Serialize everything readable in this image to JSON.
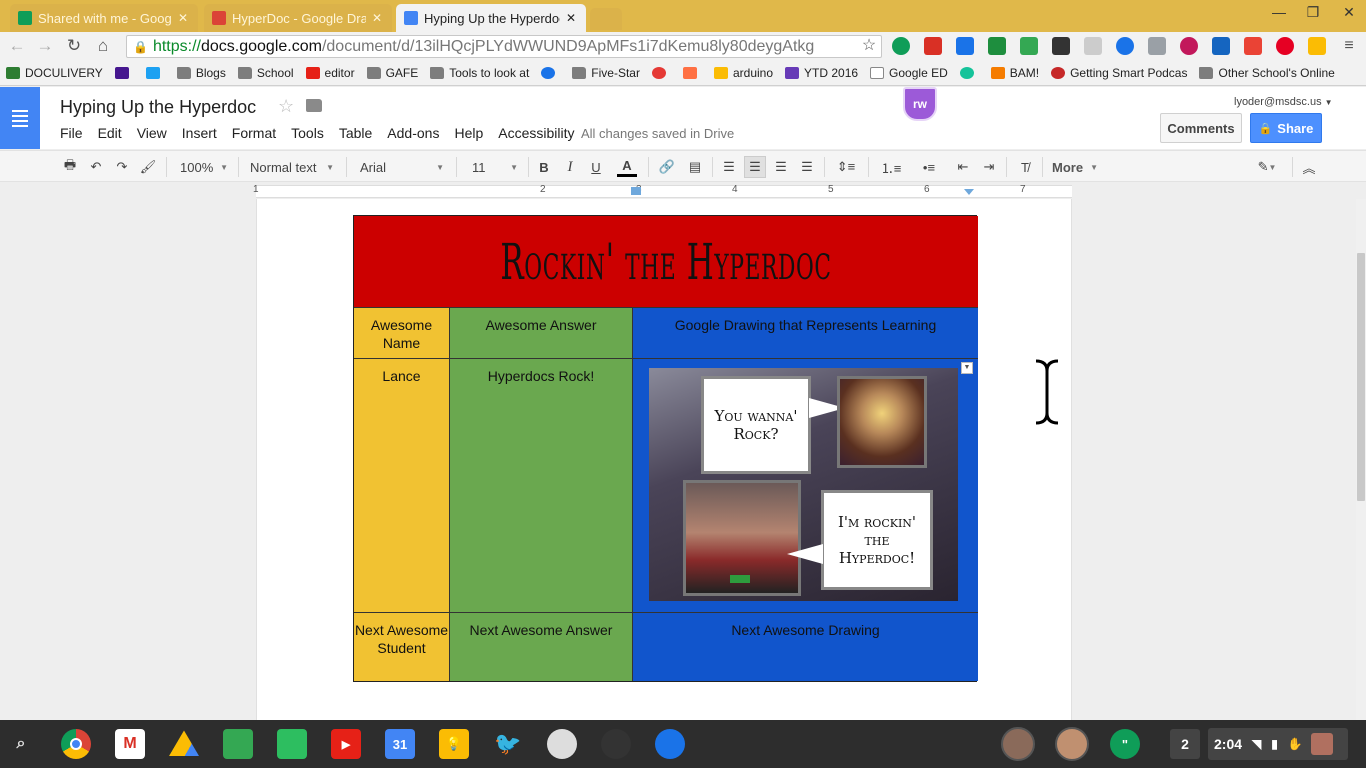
{
  "browser": {
    "tabs": [
      {
        "title": "Shared with me - Google D",
        "active": false,
        "favicon_color": "#0f9d58"
      },
      {
        "title": "HyperDoc - Google Drawi",
        "active": false,
        "favicon_color": "#db4437"
      },
      {
        "title": "Hyping Up the Hyperdoc -",
        "active": true,
        "favicon_color": "#4285f4"
      }
    ],
    "url": {
      "scheme": "https://",
      "host": "docs.google.com",
      "path": "/document/d/13ilHQcjPLYdWWUND9ApMFs1i7dKemu8ly80deygAtkg"
    },
    "bookmarks": [
      {
        "label": "DOCULIVERY",
        "icon": "doculivery-icon"
      },
      {
        "label": "",
        "icon": "kahoot-icon"
      },
      {
        "label": "",
        "icon": "twitter-icon"
      },
      {
        "label": "Blogs",
        "icon": "folder-icon"
      },
      {
        "label": "School",
        "icon": "folder-icon"
      },
      {
        "label": "editor",
        "icon": "youtube-icon"
      },
      {
        "label": "GAFE",
        "icon": "folder-icon"
      },
      {
        "label": "Tools to look at",
        "icon": "folder-icon"
      },
      {
        "label": "",
        "icon": "clock-icon"
      },
      {
        "label": "Five-Star",
        "icon": "folder-icon"
      },
      {
        "label": "",
        "icon": "app-icon"
      },
      {
        "label": "",
        "icon": "app-icon"
      },
      {
        "label": "arduino",
        "icon": "drive-icon"
      },
      {
        "label": "YTD 2016",
        "icon": "forms-icon"
      },
      {
        "label": "Google ED",
        "icon": "page-icon"
      },
      {
        "label": "",
        "icon": "grammarly-icon"
      },
      {
        "label": "BAM!",
        "icon": "bam-icon"
      },
      {
        "label": "Getting Smart Podcas",
        "icon": "podcast-icon"
      },
      {
        "label": "Other School's Online",
        "icon": "folder-icon"
      }
    ]
  },
  "docs": {
    "title": "Hyping Up the Hyperdoc",
    "menu": [
      "File",
      "Edit",
      "View",
      "Insert",
      "Format",
      "Tools",
      "Table",
      "Add-ons",
      "Help",
      "Accessibility"
    ],
    "saved_status": "All changes saved in Drive",
    "user_email": "lyoder@msdsc.us",
    "comments_label": "Comments",
    "share_label": "Share",
    "rw_label": "rw",
    "toolbar": {
      "zoom": "100%",
      "style": "Normal text",
      "font": "Arial",
      "size": "11",
      "bold": "B",
      "italic": "I",
      "underline": "U",
      "text_color": "A",
      "more": "More"
    },
    "ruler_numbers": [
      "1",
      "2",
      "3",
      "4",
      "5",
      "6",
      "7"
    ]
  },
  "table": {
    "title": "Rockin' the Hyperdoc",
    "header_row": [
      "Awesome Name",
      "Awesome Answer",
      "Google Drawing that Represents Learning"
    ],
    "row1": [
      "Lance",
      "Hyperdocs Rock!"
    ],
    "row2": [
      "Next Awesome Student",
      "Next Awesome Answer",
      "Next Awesome Drawing"
    ],
    "drawing": {
      "bubble1": "You wanna' Rock?",
      "bubble2": "I'm rockin' the Hyperdoc!"
    }
  },
  "colors": {
    "banner": "#cc0000",
    "name_col": "#f1c232",
    "answer_col": "#6aa84f",
    "drawing_col": "#1155cc",
    "share_button": "#4d90fe",
    "title_bar": "#e0b84a"
  },
  "shelf": {
    "apps": [
      "launcher-search-icon",
      "chrome-icon",
      "gmail-icon",
      "drive-icon",
      "classroom-icon",
      "evernote-icon",
      "youtube-icon",
      "calendar-icon",
      "keep-icon",
      "twitter-icon",
      "app-icon",
      "app-icon",
      "files-icon"
    ],
    "calendar_day": "31",
    "notification_count": "2",
    "time": "2:04"
  }
}
